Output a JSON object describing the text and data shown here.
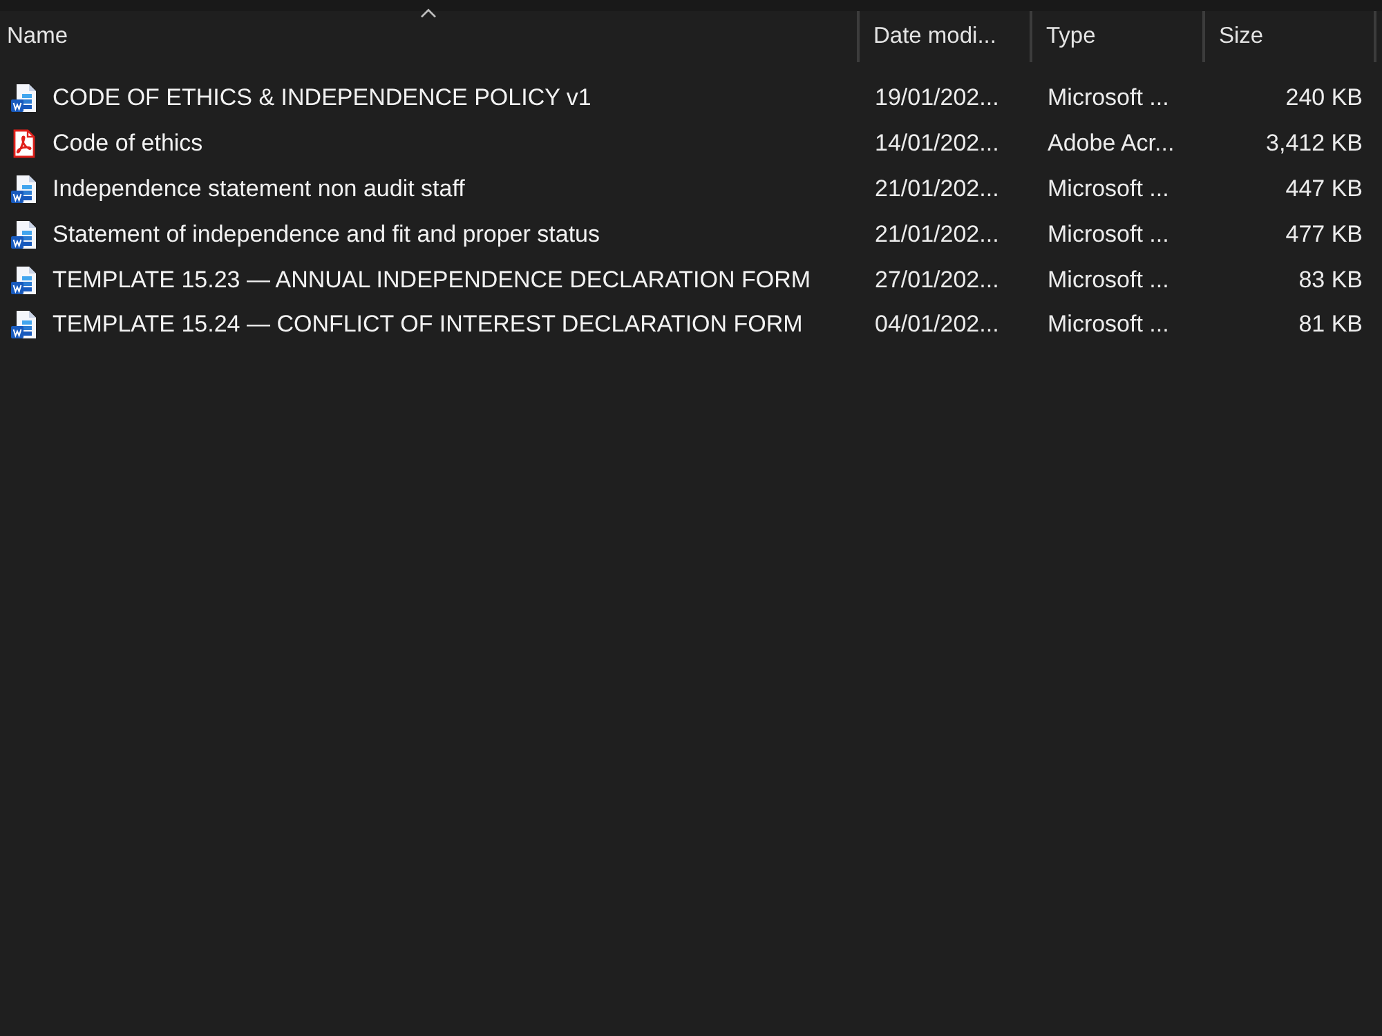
{
  "columns": [
    {
      "label": "Name",
      "sorted": true
    },
    {
      "label": "Date modi...",
      "sorted": false
    },
    {
      "label": "Type",
      "sorted": false
    },
    {
      "label": "Size",
      "sorted": false
    }
  ],
  "files": [
    {
      "kind": "word",
      "name": "CODE OF ETHICS & INDEPENDENCE POLICY v1",
      "date_modified": "19/01/202...",
      "type": "Microsoft ...",
      "size": "240 KB"
    },
    {
      "kind": "pdf",
      "name": "Code of ethics",
      "date_modified": "14/01/202...",
      "type": "Adobe Acr...",
      "size": "3,412 KB"
    },
    {
      "kind": "word",
      "name": "Independence statement non audit staff",
      "date_modified": "21/01/202...",
      "type": "Microsoft ...",
      "size": "447 KB"
    },
    {
      "kind": "word",
      "name": "Statement of independence and fit and proper status",
      "date_modified": "21/01/202...",
      "type": "Microsoft ...",
      "size": "477 KB"
    },
    {
      "kind": "word",
      "name": "TEMPLATE 15.23 — ANNUAL INDEPENDENCE DECLARATION FORM",
      "date_modified": "27/01/202...",
      "type": "Microsoft ...",
      "size": "83 KB"
    },
    {
      "kind": "word",
      "name": "TEMPLATE 15.24 — CONFLICT OF INTEREST DECLARATION FORM",
      "date_modified": "04/01/202...",
      "type": "Microsoft ...",
      "size": "81 KB"
    }
  ]
}
